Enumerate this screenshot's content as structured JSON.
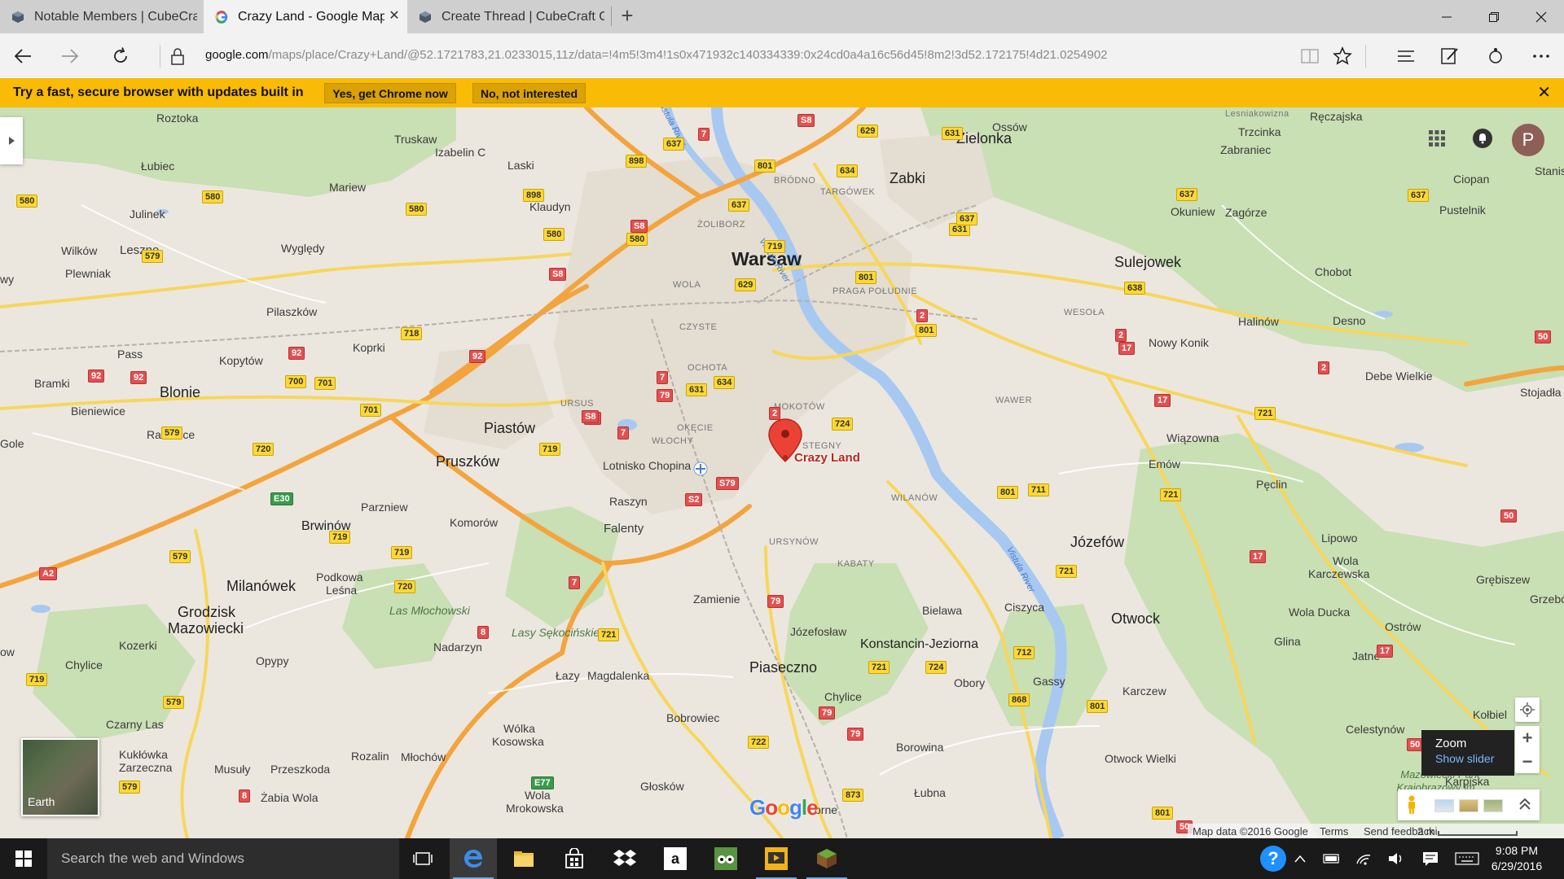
{
  "browser": {
    "tabs": [
      {
        "title": "Notable Members | CubeCraft Games"
      },
      {
        "title": "Crazy Land - Google Maps"
      },
      {
        "title": "Create Thread | CubeCraft Games"
      }
    ],
    "url": {
      "host": "google.com",
      "path": "/maps/place/Crazy+Land/@52.1721783,21.0233015,11z/data=!4m5!3m4!1s0x471932c140334339:0x24cd0a4a16c56d45!8m2!3d52.172175!4d21.0254902"
    }
  },
  "infobar": {
    "message": "Try a fast, secure browser with updates built in",
    "accept_label": "Yes, get Chrome now",
    "decline_label": "No, not interested"
  },
  "map": {
    "avatar_letter": "P",
    "marker_label": "Crazy Land",
    "earth_label": "Earth",
    "zoom_tip": {
      "title": "Zoom",
      "link": "Show slider"
    },
    "google_logo": "Google",
    "footer": {
      "map_data": "Map data ©2016 Google",
      "terms": "Terms",
      "feedback": "Send feedback",
      "scale": "2 mi"
    },
    "places": {
      "warsaw": "Warsaw",
      "zielonka": "Zielonka",
      "zabki": "Zabki",
      "sulejowek": "Sulejowek",
      "piastow": "Piastów",
      "pruszkow": "Pruszków",
      "blonie": "Blonie",
      "jozefow": "Józefów",
      "otwock": "Otwock",
      "piaseczno": "Piaseczno",
      "milanowek": "Milanówek",
      "grodzisk": "Grodzisk",
      "mazowiecki": "Mazowiecki",
      "konstancin": "Konstancin-Jeziorna",
      "brwinow": "Brwinów",
      "roztoka": "Roztoka",
      "truskaw": "Truskaw",
      "izabelin": "Izabelin C",
      "laski": "Laski",
      "lubiec": "Łubiec",
      "mariew": "Mariew",
      "klaudyn": "Klaudyn",
      "julinek": "Julinek",
      "wilkow": "Wilków",
      "leszno": "Leszno",
      "wyglady": "Wyględy",
      "plewniak": "Plewniak",
      "pilaszkow": "Pilaszków",
      "pass": "Pass",
      "kopytow": "Kopytów",
      "koprki": "Koprki",
      "bramki": "Bramki",
      "bieniewice": "Bieniewice",
      "radonice": "Radonice",
      "gole": "Gole",
      "wy": "wy",
      "ow": "ow",
      "parzniew": "Parzniew",
      "komorow": "Komorów",
      "raszyn": "Raszyn",
      "falenty": "Falenty",
      "lotnisko": "Lotnisko Chopina",
      "podkowa": "Podkowa",
      "lesna": "Leśna",
      "kozerki": "Kozerki",
      "opypy": "Opypy",
      "chylice": "Chylice",
      "nadarzyn": "Nadarzyn",
      "zamienie": "Zamienie",
      "lazy": "Łazy",
      "magdalenka": "Magdalenka",
      "jozefoslaw": "Józefosław",
      "bielawa": "Bielawa",
      "ciszyca": "Ciszyca",
      "obory": "Obory",
      "gassy": "Gassy",
      "karczew": "Karczew",
      "chylice2": "Chylice",
      "bobrowiec": "Bobrowiec",
      "borowina": "Borowina",
      "otwock_wielki": "Otwock Wielki",
      "glosków": "Głosków",
      "lubna": "Łubna",
      "orne": "orne",
      "wolka": "Wólka",
      "kosowska": "Kosowska",
      "wola": "Wola",
      "mrokowska": "Mrokowska",
      "rozalin": "Rozalin",
      "mlochow": "Młochów",
      "przeszkoda": "Przeszkoda",
      "musuly": "Musuły",
      "zabia": "Żabia Wola",
      "czarny_las": "Czarny Las",
      "kuklowka": "Kukłówka",
      "zarzeczna": "Zarzeczna",
      "ossow": "Ossów",
      "reczajska": "Ręczajska",
      "trzcinka": "Trzcinka",
      "zabraniec": "Zabraniec",
      "ciopan": "Ciopan",
      "stanis": "Stanis",
      "okuniew": "Okuniew",
      "zagorze": "Zagórze",
      "pustelnik": "Pustelnik",
      "chobot": "Chobot",
      "halinow": "Halinów",
      "desno": "Desno",
      "nowy_konik": "Nowy Konik",
      "debe": "Debe Wielkie",
      "stojadla": "Stojadła",
      "wiazowna": "Wiązowna",
      "emow": "Emów",
      "peclin": "Pęclin",
      "lipowo": "Lipowo",
      "wola_karcz": "Wola",
      "karczewska": "Karczewska",
      "grebiszew": "Grębiszew",
      "wola_ducka": "Wola Ducka",
      "ostrow": "Ostrów",
      "glina": "Glina",
      "jatne": "Jatne",
      "celestynow": "Celestynów",
      "kolbiel": "Kołbiel",
      "karpiska": "Karpiska",
      "grzebow": "Grzebów",
      "lesniakowizna": "Lesniakowizna",
      "brodno": "BRÓDNO",
      "targowek": "TARGÓWEK",
      "zoliborz": "ŻOLIBORZ",
      "praga": "PRAGA POŁUDNIE",
      "wola_d": "WOLA",
      "czyste": "CZYSTE",
      "ochota": "OCHOTA",
      "ursus": "URSUS",
      "okecie": "OKĘCIE",
      "wlochy": "WŁOCHY",
      "mokotow": "MOKOTÓW",
      "stegny": "STEGNY",
      "wilanow": "WILANÓW",
      "ursynow": "URSYNÓW",
      "kabaty": "KABATY",
      "wawer": "WAWER",
      "wesola": "WESOŁA",
      "vistula1": "Vistula River",
      "vistula2": "Vistula River",
      "vistula3": "Vistula River",
      "las_mlochowski": "Las Młochowski",
      "lasy_sekocinskie": "Lasy Sękocińskie",
      "mazowiecki_park": "Mazowiecki Park Krajobrazowy im..."
    },
    "shields": {
      "s8a": "S8",
      "s8b": "S8",
      "s8c": "S8",
      "s8d": "S8",
      "s2a": "S2",
      "s2b": "S2",
      "s79": "S79",
      "e30": "E30",
      "e77": "E77",
      "a2": "A2",
      "r7a": "7",
      "r7b": "7",
      "r7c": "7",
      "r7d": "7",
      "r2a": "2",
      "r2b": "2",
      "r2c": "2",
      "r2d": "2",
      "r17a": "17",
      "r17b": "17",
      "r17c": "17",
      "r17d": "17",
      "r79a": "79",
      "r79b": "79",
      "r79c": "79",
      "r79d": "79",
      "r92a": "92",
      "r92b": "92",
      "r92c": "92",
      "r92d": "92",
      "r8a": "8",
      "r8b": "8",
      "r50a": "50",
      "r50b": "50",
      "r50c": "50",
      "r50d": "50",
      "y629a": "629",
      "y629b": "629",
      "y631a": "631",
      "y631b": "631",
      "y631c": "631",
      "y631d": "631",
      "y637a": "637",
      "y637b": "637",
      "y637c": "637",
      "y637d": "637",
      "y637e": "637",
      "y898a": "898",
      "y898b": "898",
      "y801a": "801",
      "y801b": "801",
      "y801c": "801",
      "y801d": "801",
      "y801e": "801",
      "y801f": "801",
      "y634a": "634",
      "y634b": "634",
      "y580a": "580",
      "y580b": "580",
      "y580c": "580",
      "y580d": "580",
      "y580e": "580",
      "y719a": "719",
      "y719b": "719",
      "y719c": "719",
      "y719d": "719",
      "y719e": "719",
      "y579a": "579",
      "y579b": "579",
      "y579c": "579",
      "y579d": "579",
      "y579e": "579",
      "y718": "718",
      "y700": "700",
      "y701a": "701",
      "y701b": "701",
      "y720a": "720",
      "y720b": "720",
      "y721a": "721",
      "y721b": "721",
      "y721c": "721",
      "y721d": "721",
      "y721e": "721",
      "y724a": "724",
      "y724b": "724",
      "y722": "722",
      "y712": "712",
      "y711": "711",
      "y868": "868",
      "y873": "873",
      "y638": "638"
    }
  }
}
